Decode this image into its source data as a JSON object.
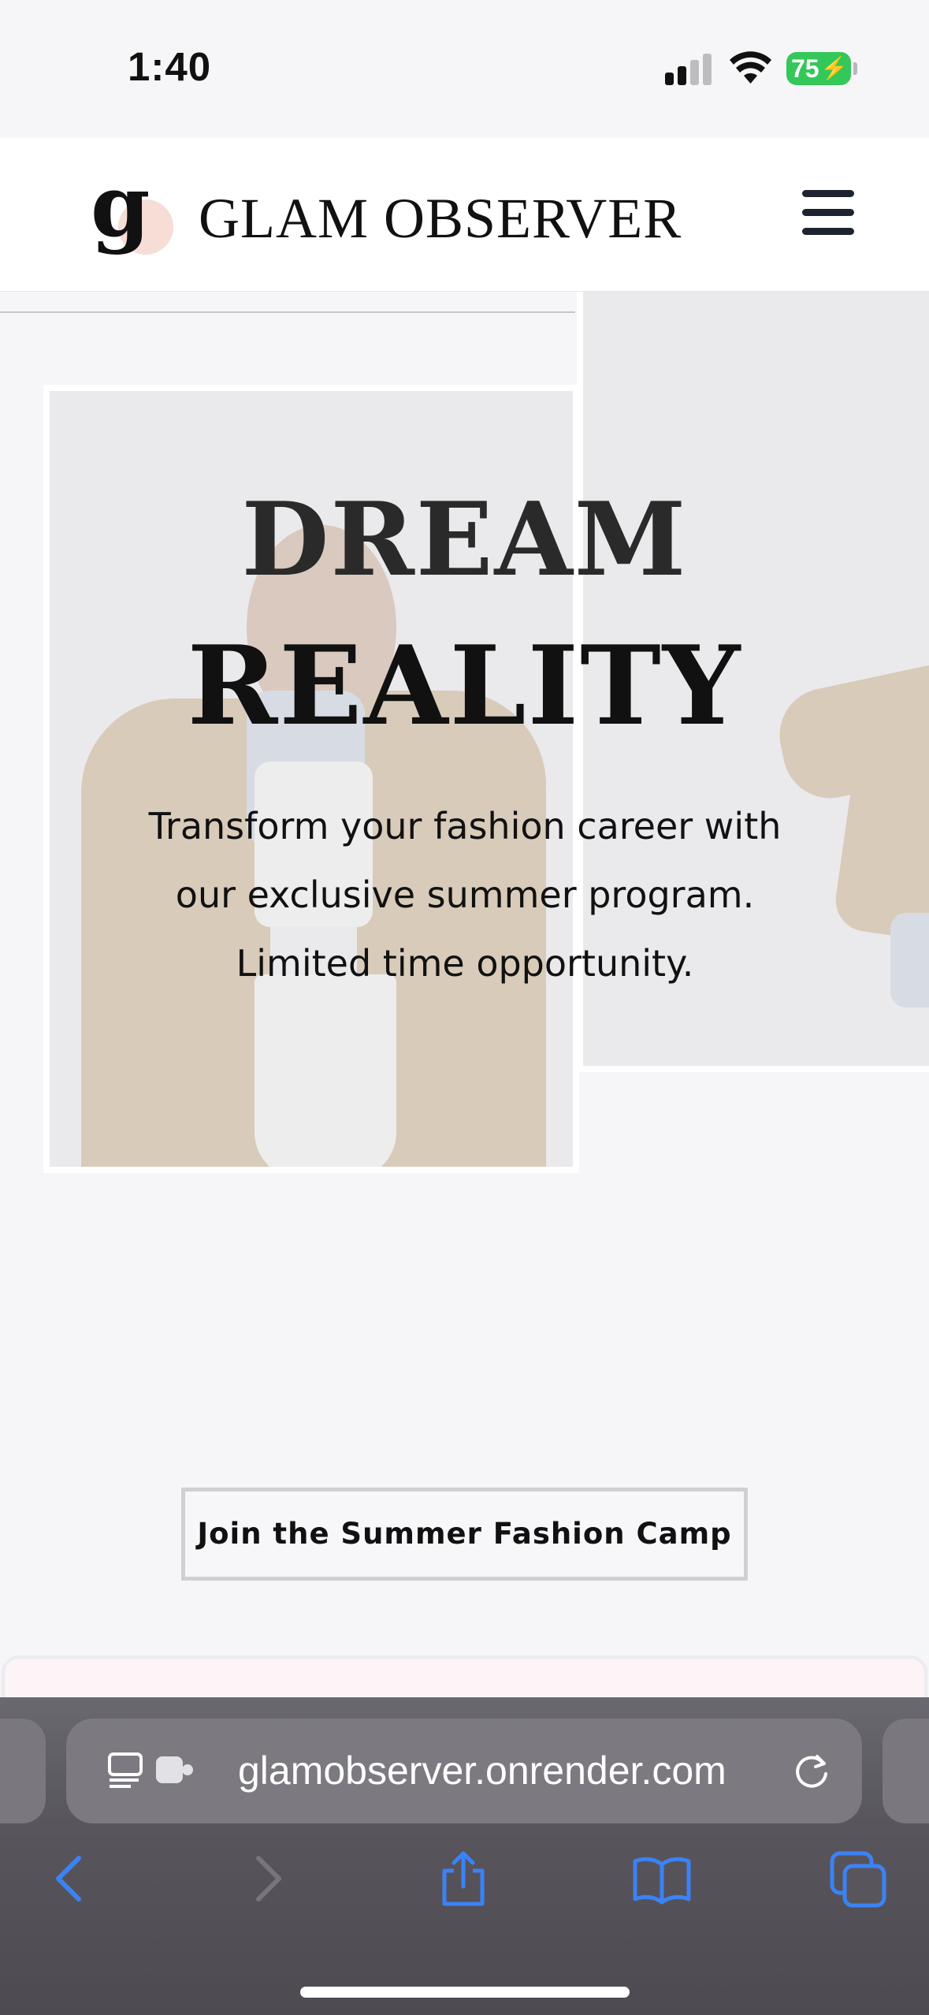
{
  "status_bar": {
    "time": "1:40",
    "battery": "75"
  },
  "header": {
    "logo_letter": "g",
    "brand": "GLAM OBSERVER"
  },
  "hero": {
    "title_line1": "DREAM",
    "title_line2": "REALITY",
    "subtitle_lines": [
      "Transform your fashion career with",
      "our exclusive summer program.",
      "Limited time opportunity."
    ]
  },
  "cta": {
    "label": "Join the Summer Fashion Camp"
  },
  "browser": {
    "url": "glamobserver.onrender.com"
  },
  "icons": [
    "signal-icon",
    "wifi-icon",
    "battery-icon",
    "menu-icon",
    "page-settings-icon",
    "extension-icon",
    "reload-icon",
    "back-icon",
    "forward-icon",
    "share-icon",
    "bookmarks-icon",
    "tabs-icon"
  ],
  "colors": {
    "accent_blob": "#f6ddd6",
    "battery_green": "#34c759",
    "safari_blue": "#3b82f6"
  }
}
